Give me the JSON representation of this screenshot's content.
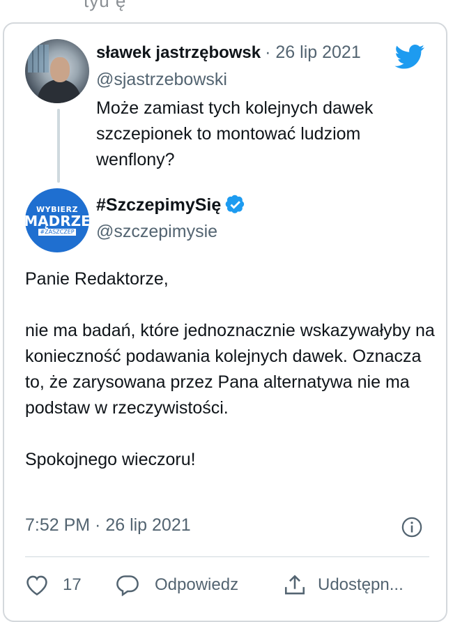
{
  "top_fragment": "tyu  ę",
  "reply_tweet": {
    "author_name": "sławek jastrzębowsk",
    "date": "· 26 lip 2021",
    "handle": "@sjastrzebowski",
    "text": "Może zamiast tych kolejnych dawek szczepionek to montować ludziom wenflony?",
    "platform_icon": "twitter-bird-icon",
    "brand_color": "#1d9bf0"
  },
  "main_tweet": {
    "author_name": "#SzczepimySię",
    "verified": true,
    "handle": "@szczepimysie",
    "avatar_logo": {
      "line1": "WYBIERZ",
      "line2": "MĄDRZE",
      "line3": "#ZASZCZEP"
    },
    "paragraphs": [
      "Panie Redaktorze,",
      "nie ma badań, które jednoznacznie wskazywałyby na konieczność podawania kolejnych dawek. Oznacza to, że zarysowana przez Pana alternatywa nie ma podstaw w rzeczywistości.",
      "Spokojnego wieczoru!"
    ],
    "timestamp": "7:52 PM · 26 lip 2021"
  },
  "actions": {
    "like_count": "17",
    "reply_label": "Odpowiedz",
    "share_label": "Udostępn..."
  }
}
